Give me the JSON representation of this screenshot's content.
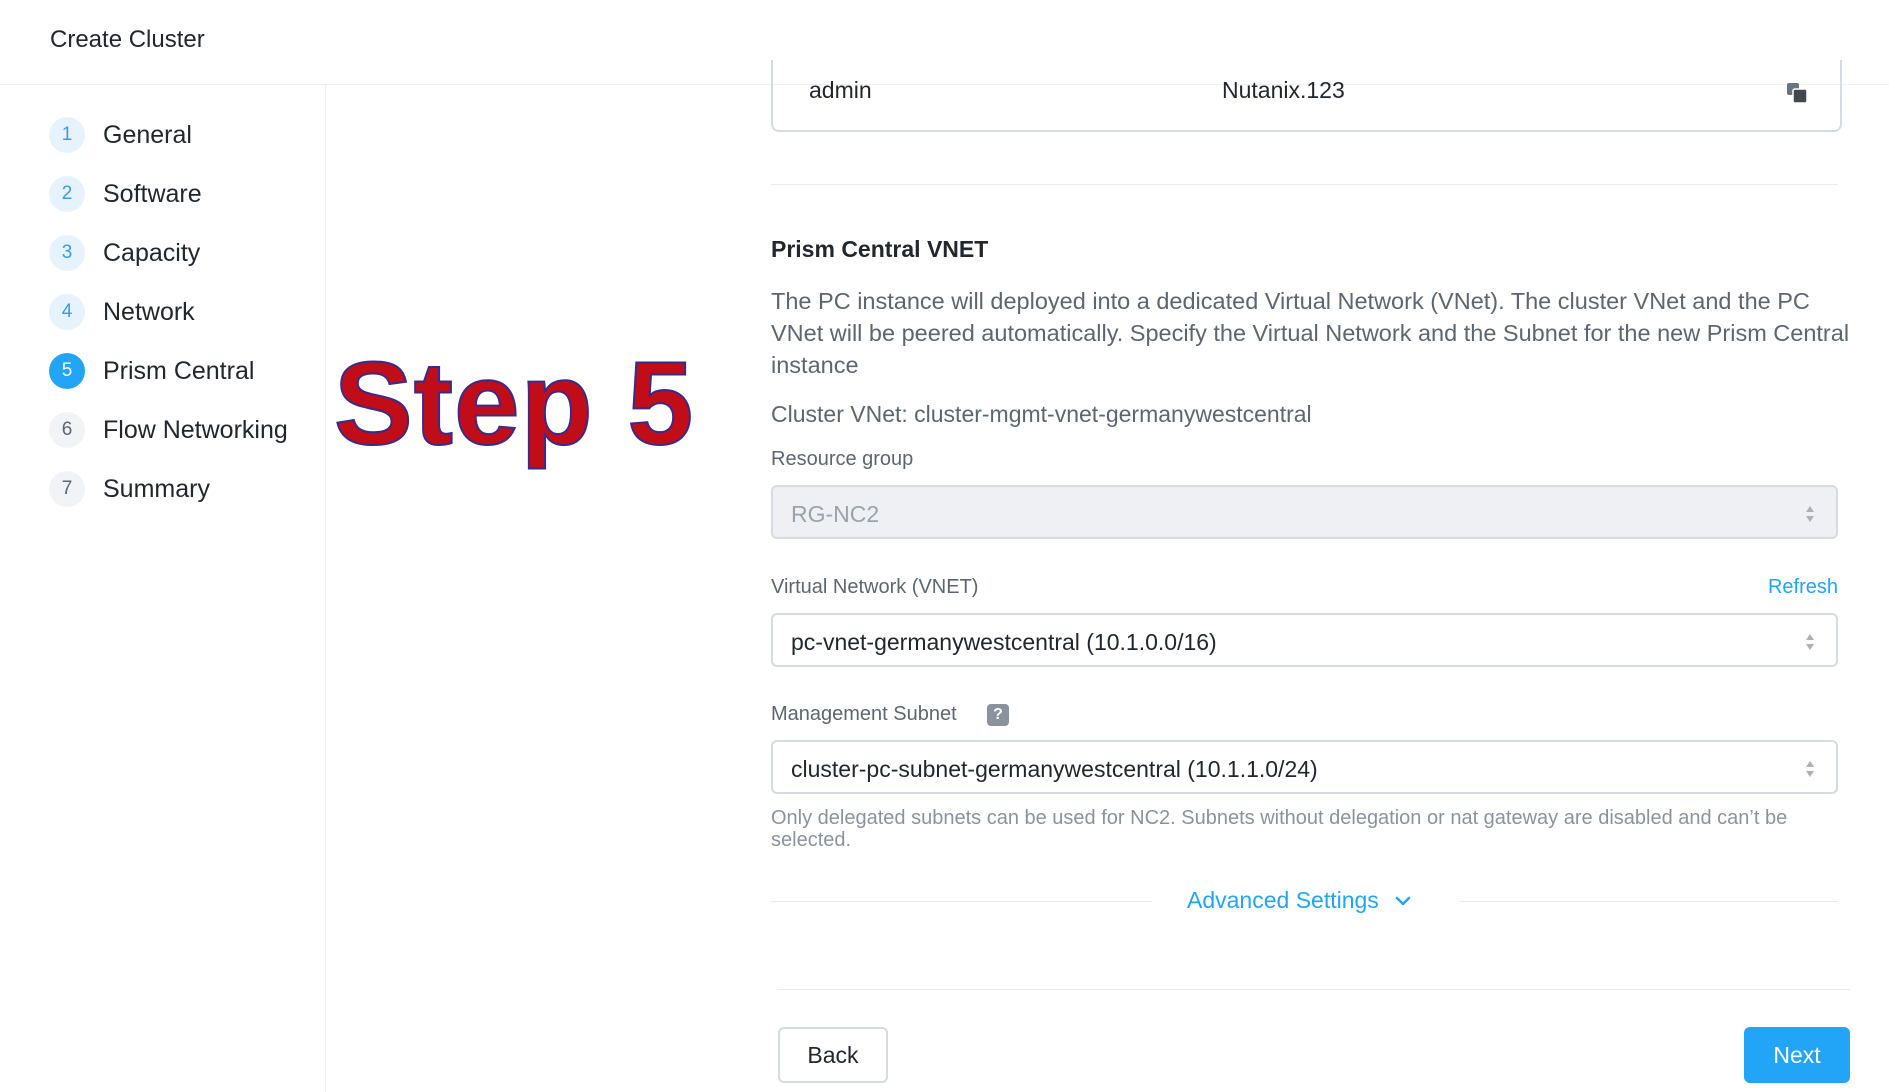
{
  "header": {
    "title": "Create Cluster"
  },
  "steps": [
    {
      "num": "1",
      "label": "General"
    },
    {
      "num": "2",
      "label": "Software"
    },
    {
      "num": "3",
      "label": "Capacity"
    },
    {
      "num": "4",
      "label": "Network"
    },
    {
      "num": "5",
      "label": "Prism Central"
    },
    {
      "num": "6",
      "label": "Flow Networking"
    },
    {
      "num": "7",
      "label": "Summary"
    }
  ],
  "overlay": {
    "text": "Step 5"
  },
  "credentials": {
    "username": "admin",
    "password": "Nutanix.123",
    "copy_icon": "copy-icon"
  },
  "prism_vnet": {
    "title": "Prism Central VNET",
    "description": "The PC instance will deployed into a dedicated Virtual Network (VNet). The cluster VNet and the PC VNet will be peered automatically. Specify the Virtual Network and the Subnet for the new Prism Central instance",
    "cluster_vnet": "Cluster VNet: cluster-mgmt-vnet-germanywestcentral",
    "resource_group_label": "Resource group",
    "resource_group_value": "RG-NC2",
    "vnet_label": "Virtual Network (VNET)",
    "refresh_label": "Refresh",
    "vnet_value": "pc-vnet-germanywestcentral (10.1.0.0/16)",
    "subnet_label": "Management Subnet",
    "help_glyph": "?",
    "subnet_value": "cluster-pc-subnet-germanywestcentral (10.1.1.0/24)",
    "subnet_hint": "Only delegated subnets can be used for NC2. Subnets without delegation or nat gateway are disabled and can’t be selected.",
    "advanced_label": "Advanced Settings"
  },
  "footer": {
    "back_label": "Back",
    "next_label": "Next"
  },
  "colors": {
    "accent": "#22a5f7",
    "overlay_red": "#c10d18"
  }
}
